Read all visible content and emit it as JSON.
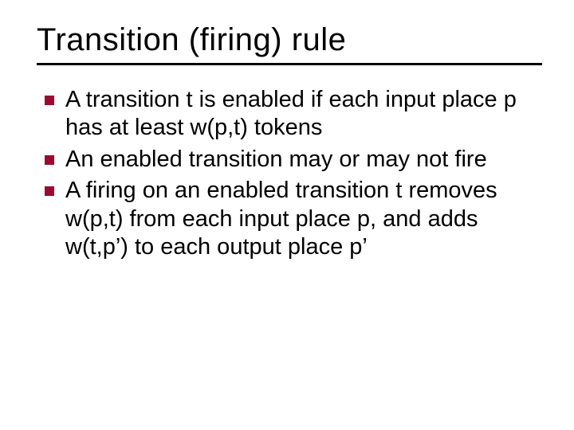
{
  "slide": {
    "title": "Transition (firing) rule",
    "bullets": [
      "A transition t is enabled if each input place p has at least w(p,t) tokens",
      "An enabled transition may or may not fire",
      "A firing on an enabled transition t removes w(p,t) from each input place p, and adds w(t,p’) to each output place p’"
    ]
  },
  "colors": {
    "bullet": "#9b0b30"
  }
}
